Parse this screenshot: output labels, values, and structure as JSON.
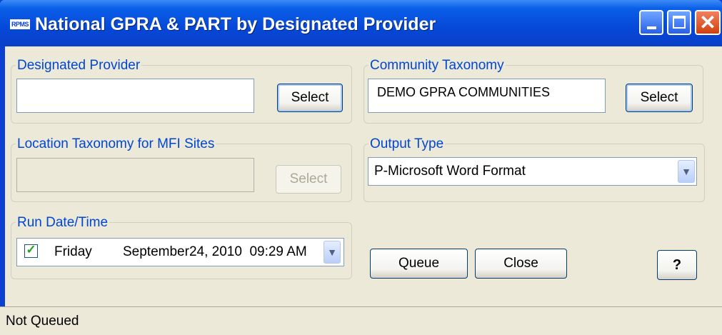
{
  "window": {
    "title": "National GPRA & PART by Designated Provider",
    "app_icon_text": "RPMS",
    "controls": [
      "minimize-icon",
      "maximize-icon",
      "close-icon"
    ]
  },
  "designated_provider": {
    "legend": "Designated Provider",
    "value": "",
    "select_label": "Select"
  },
  "community_taxonomy": {
    "legend": "Community Taxonomy",
    "value": "DEMO GPRA COMMUNITIES",
    "select_label": "Select"
  },
  "location_taxonomy": {
    "legend": "Location Taxonomy for MFI Sites",
    "value": "",
    "select_label": "Select",
    "enabled": false
  },
  "output_type": {
    "legend": "Output Type",
    "selected": "P-Microsoft Word Format"
  },
  "run_datetime": {
    "legend": "Run Date/Time",
    "checked": true,
    "day": "Friday",
    "date_time": "September24, 2010  09:29 AM"
  },
  "actions": {
    "queue_label": "Queue",
    "close_label": "Close",
    "help_label": "?"
  },
  "status_bar": {
    "text": "Not Queued"
  },
  "colors": {
    "title_bar": "#0548d8",
    "legend_text": "#0046d5",
    "dialog_background": "#ece9d8",
    "check_mark": "#21a121"
  }
}
